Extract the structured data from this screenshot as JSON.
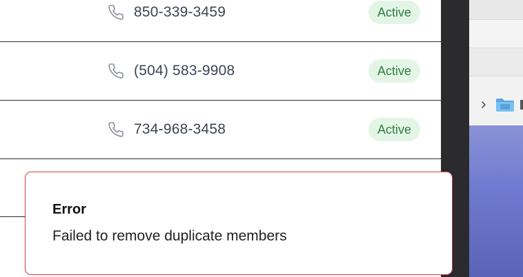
{
  "contacts": [
    {
      "phone": "850-339-3459",
      "status": "Active"
    },
    {
      "phone": "(504) 583-9908",
      "status": "Active"
    },
    {
      "phone": "734-968-3458",
      "status": "Active"
    }
  ],
  "toast": {
    "title": "Error",
    "message": "Failed to remove duplicate members"
  },
  "colors": {
    "status_active_bg": "#e3f6e6",
    "status_active_text": "#2e7d43",
    "error_border": "#d0464a"
  },
  "icons": {
    "phone": "phone-icon",
    "chevron": "chevron-right-icon",
    "folder": "folder-icon"
  }
}
